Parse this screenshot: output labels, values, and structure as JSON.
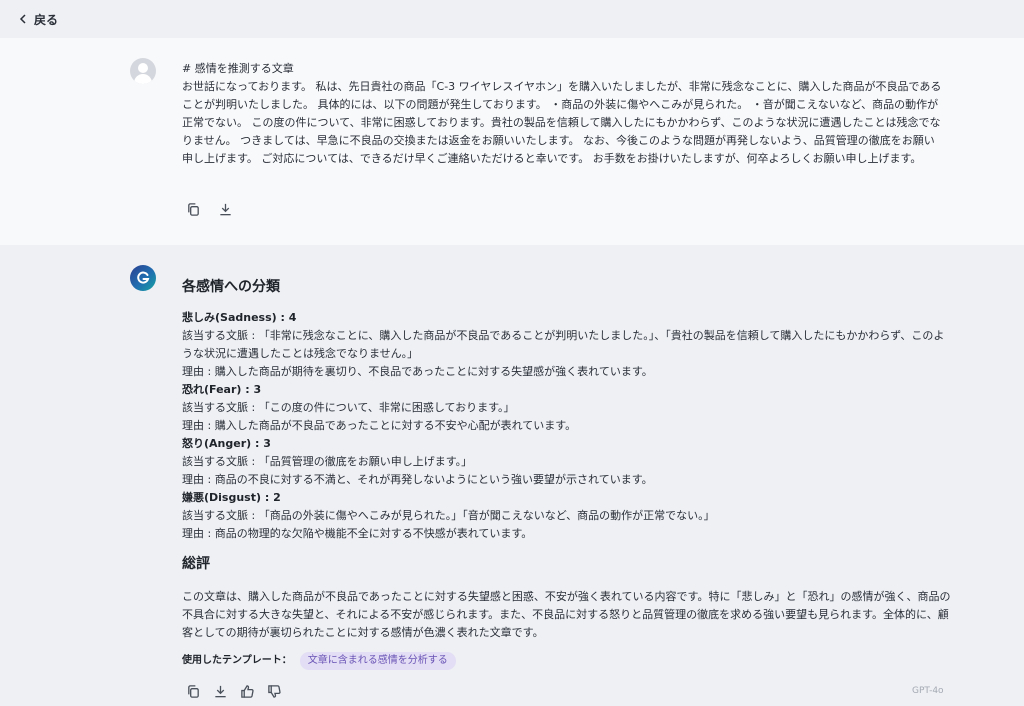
{
  "topbar": {
    "back_label": "戻る"
  },
  "user_message": {
    "title": "# 感情を推測する文章",
    "body": "お世話になっております。 私は、先日貴社の商品「C-3 ワイヤレスイヤホン」を購入いたしましたが、非常に残念なことに、購入した商品が不良品であることが判明いたしました。 具体的には、以下の問題が発生しております。 ・商品の外装に傷やへこみが見られた。 ・音が聞こえないなど、商品の動作が正常でない。 この度の件について、非常に困惑しております。貴社の製品を信頼して購入したにもかかわらず、このような状況に遭遇したことは残念でなりません。 つきましては、早急に不良品の交換または返金をお願いいたします。 なお、今後このような問題が再発しないよう、品質管理の徹底をお願い申し上げます。 ご対応については、できるだけ早くご連絡いただけると幸いです。 お手数をお掛けいたしますが、何卒よろしくお願い申し上げます。"
  },
  "assistant_message": {
    "heading1": "各感情への分類",
    "emotions": [
      {
        "head": "悲しみ(Sadness) : 4",
        "context": "該当する文脈 : 「非常に残念なことに、購入した商品が不良品であることが判明いたしました。」、「貴社の製品を信頼して購入したにもかかわらず、このような状況に遭遇したことは残念でなりません。」",
        "reason": "理由 : 購入した商品が期待を裏切り、不良品であったことに対する失望感が強く表れています。"
      },
      {
        "head": "恐れ(Fear) : 3",
        "context": "該当する文脈 : 「この度の件について、非常に困惑しております。」",
        "reason": "理由 : 購入した商品が不良品であったことに対する不安や心配が表れています。"
      },
      {
        "head": "怒り(Anger) : 3",
        "context": "該当する文脈 : 「品質管理の徹底をお願い申し上げます。」",
        "reason": "理由 : 商品の不良に対する不満と、それが再発しないようにという強い要望が示されています。"
      },
      {
        "head": "嫌悪(Disgust) : 2",
        "context": "該当する文脈 : 「商品の外装に傷やへこみが見られた。」「音が聞こえないなど、商品の動作が正常でない。」",
        "reason": "理由 : 商品の物理的な欠陥や機能不全に対する不快感が表れています。"
      }
    ],
    "heading2": "総評",
    "summary": "この文章は、購入した商品が不良品であったことに対する失望感と困惑、不安が強く表れている内容です。特に「悲しみ」と「恐れ」の感情が強く、商品の不具合に対する大きな失望と、それによる不安が感じられます。また、不良品に対する怒りと品質管理の徹底を求める強い要望も見られます。全体的に、顧客としての期待が裏切られたことに対する感情が色濃く表れた文章です。",
    "template_label": "使用したテンプレート：",
    "template_name": "文章に含まれる感情を分析する",
    "model": "GPT-4o"
  },
  "icons": {
    "back": "chevron-left-icon",
    "copy": "copy-icon",
    "download": "download-icon",
    "like": "thumbs-up-icon",
    "dislike": "thumbs-down-icon"
  }
}
